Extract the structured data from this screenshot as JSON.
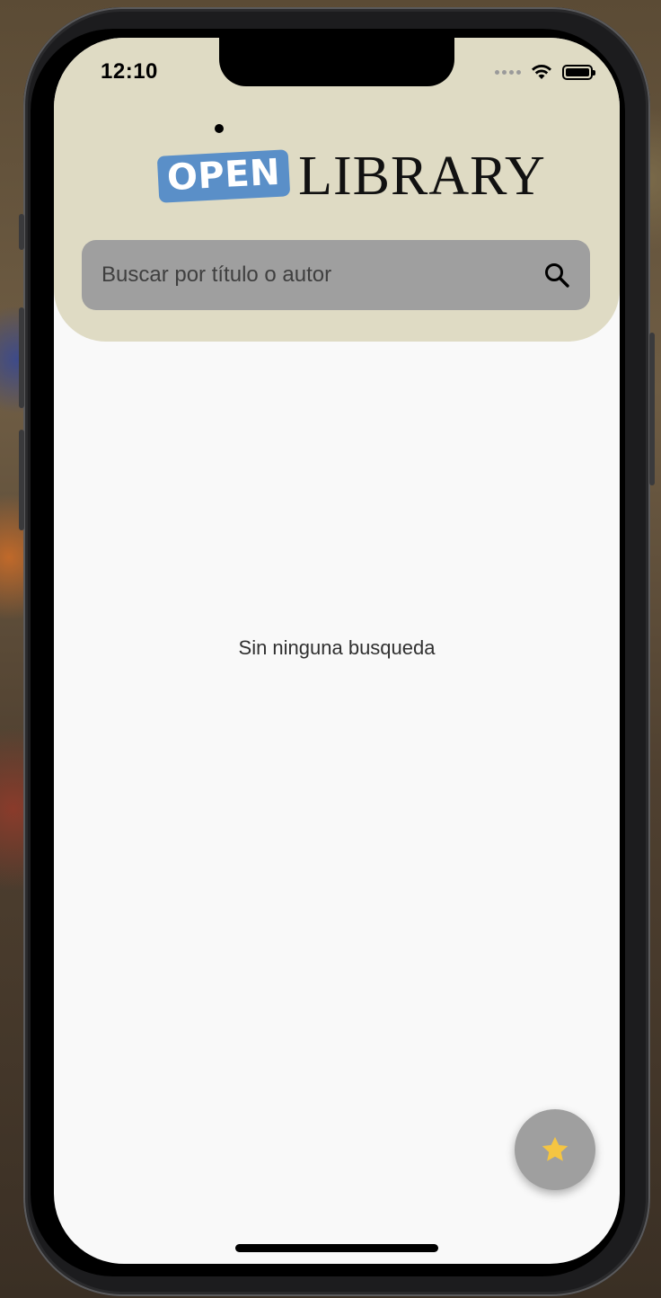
{
  "status_bar": {
    "time": "12:10"
  },
  "logo": {
    "open_text": "OPEN",
    "library_text": "LIBRARY"
  },
  "search": {
    "placeholder": "Buscar por título o autor",
    "icon": "search-icon"
  },
  "main": {
    "empty_message": "Sin ninguna busqueda"
  },
  "fab": {
    "icon": "star-icon",
    "icon_color": "#f5c542"
  },
  "colors": {
    "header_bg": "#dfdbc4",
    "search_bg": "#9f9f9f",
    "logo_blue": "#5a8fc8",
    "screen_bg": "#f9f9f9"
  }
}
